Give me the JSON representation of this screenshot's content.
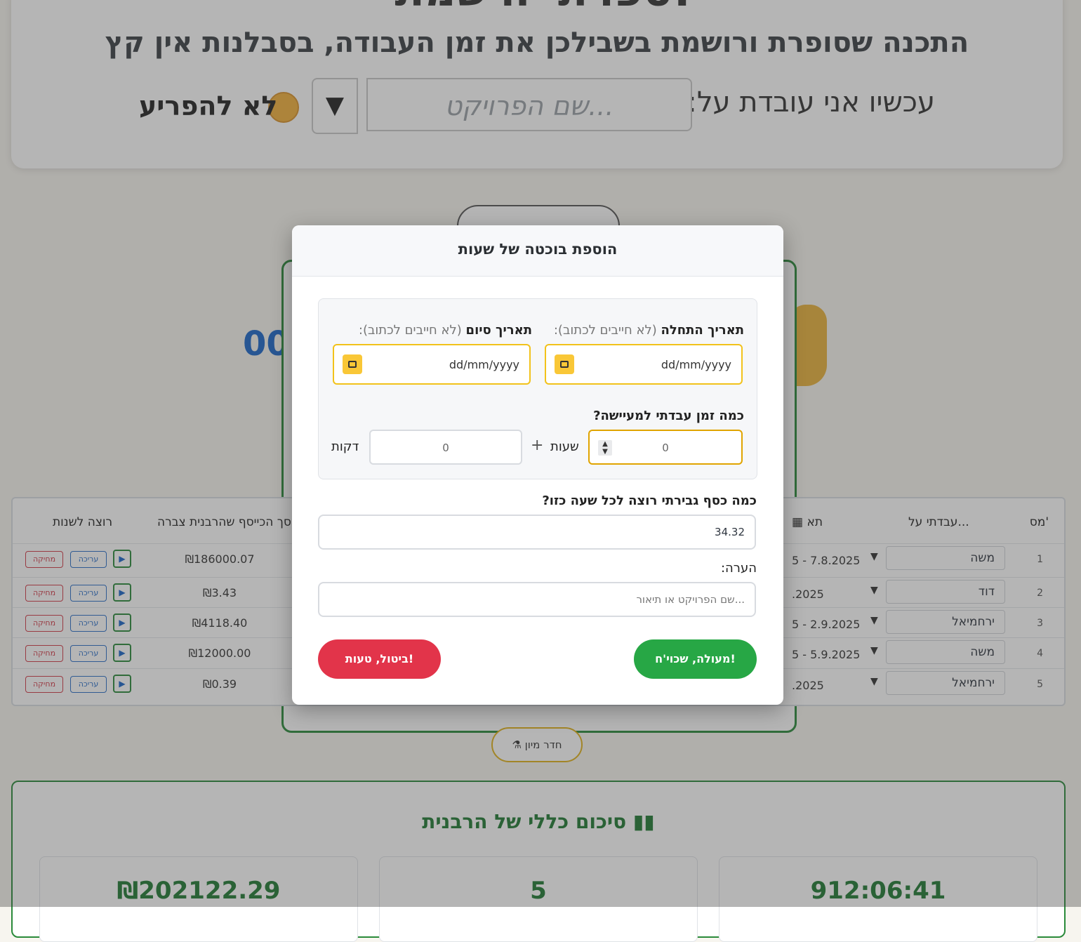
{
  "header": {
    "title": "ספרתי ורשמתי!",
    "subtitle": "התכנה שסופרת ורושמת בשבילכן את זמן העבודה, בסבלנות אין קץ",
    "working_on_label": "עכשיו אני עובדת על:",
    "project_placeholder": "שם הפרויקט...",
    "dropdown_symbol": "▼",
    "do_not_disturb": "לא להפריע"
  },
  "background": {
    "counter_fragment": "00"
  },
  "table": {
    "headers": {
      "num": "מס'",
      "worked_on": "עבדתי על...",
      "date": "תא",
      "amount": "סך הכייסף שהרבנית צברה",
      "change": "רוצה לשנות"
    },
    "rows": [
      {
        "num": "1",
        "name": "משה",
        "date": "5 - 7.8.2025",
        "amount": "₪186000.07"
      },
      {
        "num": "2",
        "name": "דוד",
        "date": ".2025",
        "amount": "₪3.43"
      },
      {
        "num": "3",
        "name": "ירחמיאל",
        "date": "5 - 2.9.2025",
        "amount": "₪4118.40"
      },
      {
        "num": "4",
        "name": "משה",
        "date": "5 - 5.9.2025",
        "amount": "₪12000.00"
      },
      {
        "num": "5",
        "name": "ירחמיאל",
        "date": ".2025",
        "amount": "₪0.39"
      }
    ],
    "edit_label": "עריכה",
    "delete_label": "מחיקה"
  },
  "sort_button": "חדר מיון",
  "summary": {
    "title": "סיכום כללי של הרבנית",
    "total_money": "₪202122.29",
    "count": "5",
    "total_time": "912:06:41"
  },
  "modal": {
    "title": "הוספת בוכטה של שעות",
    "start_date_label": "תאריך התחלה",
    "end_date_label": "תאריך סיום",
    "optional_note": "(לא חייבים לכתוב):",
    "date_placeholder": "dd/mm/yyyy",
    "time_question": "כמה זמן עבדתי למעיישה?",
    "hours_value": "0",
    "hours_label": "שעות",
    "plus": "+",
    "minutes_value": "0",
    "minutes_label": "דקות",
    "rate_question": "כמה כסף גבירתי רוצה לכל שעה כזו?",
    "rate_value": "34.32",
    "note_label": "הערה:",
    "note_placeholder": "שם הפרויקט או תיאור...",
    "confirm_label": "מעולה, שכוי'ח!",
    "cancel_label": "ביטול, טעות!"
  }
}
